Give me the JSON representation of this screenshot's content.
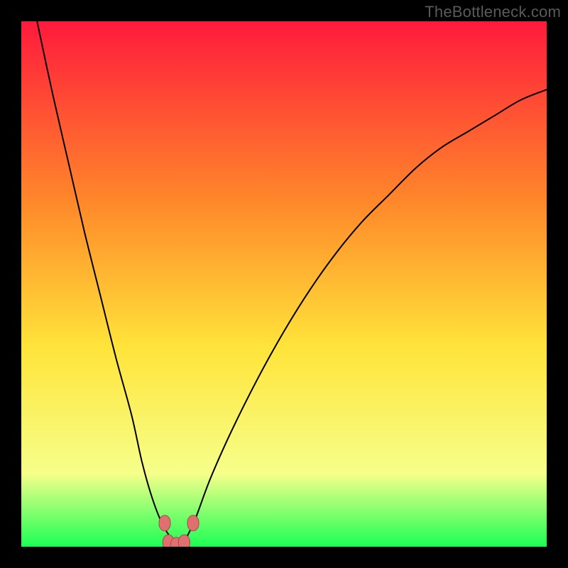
{
  "watermark": "TheBottleneck.com",
  "colors": {
    "page_bg": "#000000",
    "gradient_top": "#ff1a3c",
    "gradient_mid1": "#ff8a2a",
    "gradient_mid2": "#ffe43a",
    "gradient_mid3": "#f6ff8a",
    "gradient_bottom": "#1cff55",
    "curve": "#000000",
    "marker_fill": "#e07070",
    "marker_stroke": "#a14a4a"
  },
  "chart_data": {
    "type": "line",
    "title": "",
    "xlabel": "",
    "ylabel": "",
    "xlim": [
      0,
      100
    ],
    "ylim": [
      0,
      100
    ],
    "grid": false,
    "background": "red-yellow-green vertical gradient",
    "series": [
      {
        "name": "bottleneck-curve",
        "x": [
          3,
          6,
          9,
          12,
          15,
          18,
          21,
          23,
          25,
          27,
          29,
          30,
          31,
          33,
          36,
          40,
          45,
          50,
          55,
          60,
          65,
          70,
          75,
          80,
          85,
          90,
          95,
          100
        ],
        "values": [
          100,
          86,
          73,
          60,
          48,
          36,
          25,
          16,
          9,
          4,
          1,
          0,
          1,
          5,
          13,
          22,
          32,
          41,
          49,
          56,
          62,
          67,
          72,
          76,
          79,
          82,
          85,
          87
        ]
      }
    ],
    "markers": [
      {
        "x": 27.3,
        "y": 4.5
      },
      {
        "x": 28.0,
        "y": 0.8
      },
      {
        "x": 29.5,
        "y": 0.3
      },
      {
        "x": 31.0,
        "y": 0.8
      },
      {
        "x": 32.7,
        "y": 4.5
      }
    ],
    "legend": false
  }
}
